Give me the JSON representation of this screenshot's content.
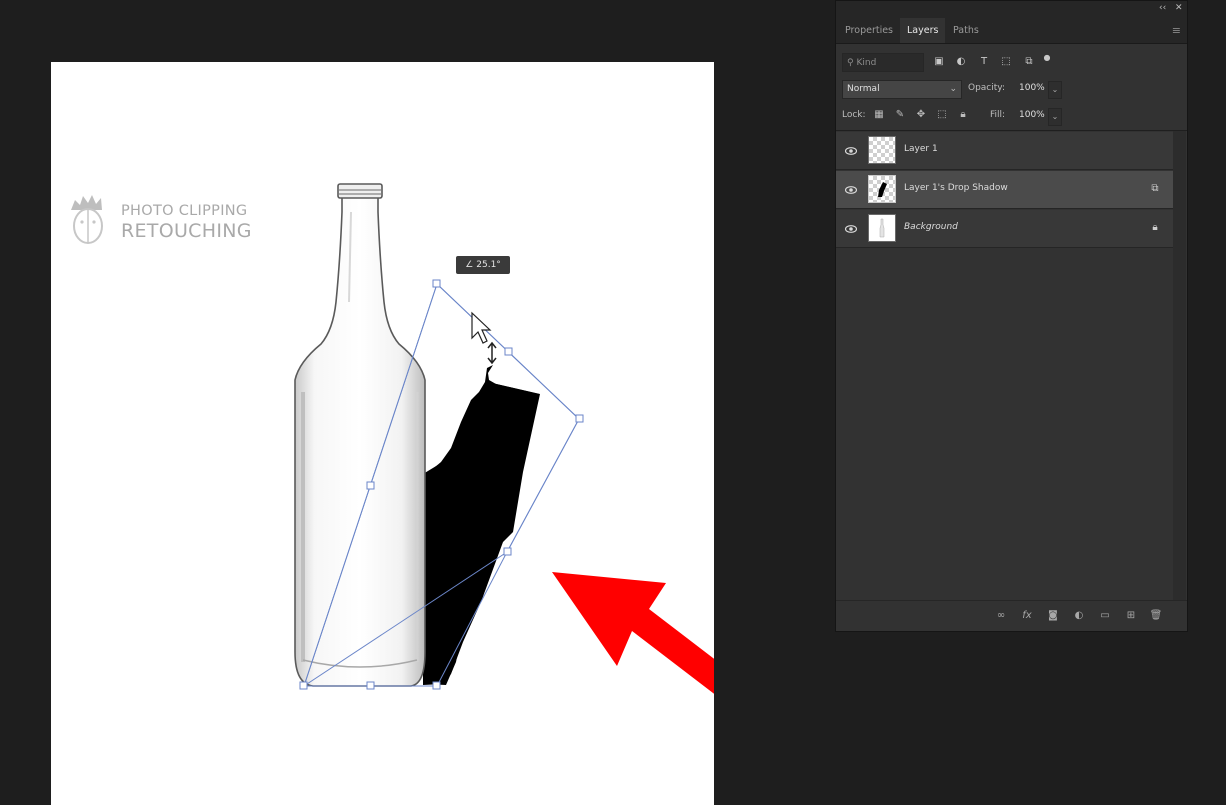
{
  "panel": {
    "topbar": {
      "collapse_glyph": "‹‹",
      "close_glyph": "✕"
    },
    "tabs": [
      {
        "label": "Properties",
        "active": false
      },
      {
        "label": "Layers",
        "active": true
      },
      {
        "label": "Paths",
        "active": false
      }
    ],
    "menu_glyph": "≡",
    "filter": {
      "placeholder": "Kind",
      "search_glyph": "⚲"
    },
    "blend": {
      "mode": "Normal",
      "opacity_label": "Opacity:",
      "opacity_value": "100%"
    },
    "locks": {
      "label": "Lock:",
      "fill_label": "Fill:",
      "fill_value": "100%"
    },
    "layers": [
      {
        "name": "Layer 1",
        "visible": true,
        "selected": false,
        "badge": ""
      },
      {
        "name": "Layer 1's Drop Shadow",
        "visible": true,
        "selected": true,
        "badge": "smart-object-icon"
      },
      {
        "name": "Background",
        "visible": true,
        "selected": false,
        "badge": "lock-icon"
      }
    ],
    "footer_icons": [
      "link-icon",
      "fx-icon",
      "mask-icon",
      "adjustment-icon",
      "folder-icon",
      "new-layer-icon",
      "trash-icon"
    ]
  },
  "canvas": {
    "watermark": {
      "line1": "PHOTO CLIPPING",
      "line2": "RETOUCHING"
    },
    "transform_tooltip": {
      "angle": "25.1°"
    },
    "colors": {
      "arrow": "#ff0000",
      "shadow": "#000000",
      "bbox": "#6b86c9",
      "canvas_bg": "#ffffff"
    }
  }
}
